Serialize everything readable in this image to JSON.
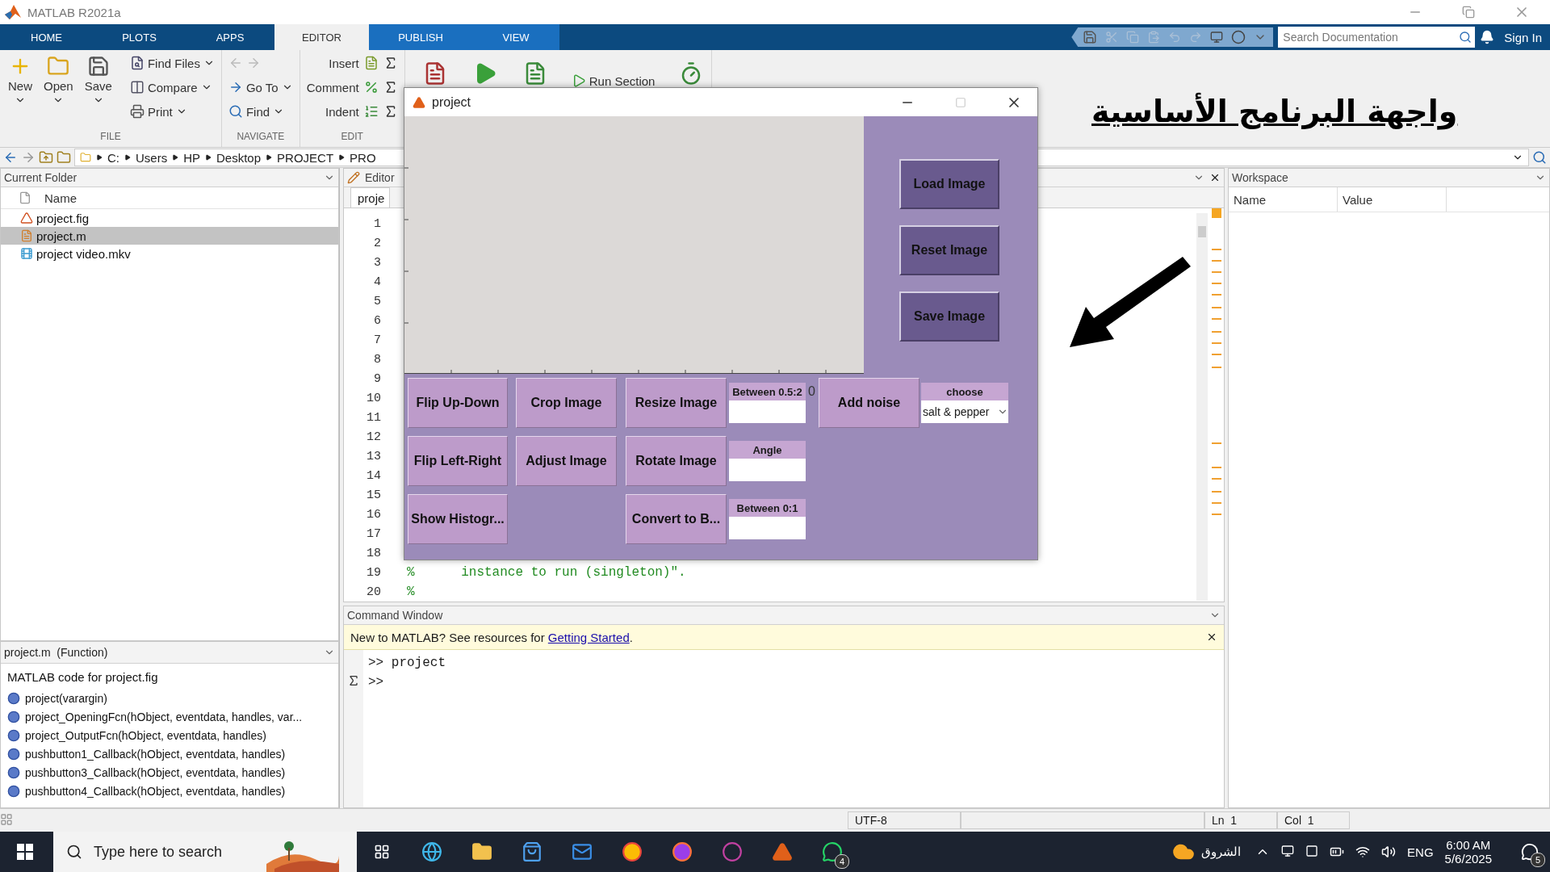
{
  "window": {
    "title": "MATLAB R2021a"
  },
  "ribbon_tabs": [
    {
      "label": "HOME",
      "selected": false,
      "contextual": false
    },
    {
      "label": "PLOTS",
      "selected": false,
      "contextual": false
    },
    {
      "label": "APPS",
      "selected": false,
      "contextual": false
    },
    {
      "label": "EDITOR",
      "selected": true,
      "contextual": false
    },
    {
      "label": "PUBLISH",
      "selected": false,
      "contextual": true
    },
    {
      "label": "VIEW",
      "selected": false,
      "contextual": true
    }
  ],
  "search": {
    "placeholder": "Search Documentation"
  },
  "sign_in": "Sign In",
  "toolstrip": [
    {
      "title": "FILE",
      "items": [
        {
          "label": "New",
          "kind": "large"
        },
        {
          "label": "Open",
          "kind": "large"
        },
        {
          "label": "Save",
          "kind": "large"
        },
        {
          "label": "Find Files",
          "kind": "small"
        },
        {
          "label": "Compare",
          "kind": "small"
        },
        {
          "label": "Print",
          "kind": "small"
        }
      ]
    },
    {
      "title": "NAVIGATE",
      "items": [
        {
          "kind": "arrows"
        },
        {
          "label": "Go To",
          "kind": "small"
        },
        {
          "label": "Find",
          "kind": "small"
        }
      ]
    },
    {
      "title": "EDIT",
      "items": [
        {
          "label": "Insert",
          "kind": "tool"
        },
        {
          "label": "Comment",
          "kind": "tool"
        },
        {
          "label": "Indent",
          "kind": "tool"
        }
      ]
    },
    {
      "items": [
        {
          "kind": "icon"
        },
        {
          "kind": "icon"
        },
        {
          "kind": "icon"
        },
        {
          "label": "Run Section",
          "kind": "small"
        },
        {
          "kind": "icon"
        }
      ]
    }
  ],
  "address_bar": {
    "path": [
      "C:",
      "Users",
      "HP",
      "Desktop",
      "PROJECT",
      "PRO"
    ]
  },
  "current_folder": {
    "title": "Current Folder",
    "column": "Name",
    "files": [
      {
        "name": "project.fig",
        "selected": false
      },
      {
        "name": "project.m",
        "selected": true
      },
      {
        "name": "project video.mkv",
        "selected": false
      }
    ]
  },
  "details": {
    "title": "project.m  (Function)",
    "description": "MATLAB code for project.fig",
    "functions": [
      "project(varargin)",
      "project_OpeningFcn(hObject, eventdata, handles, var...",
      "project_OutputFcn(hObject, eventdata, handles)",
      "pushbutton1_Callback(hObject, eventdata, handles)",
      "pushbutton3_Callback(hObject, eventdata, handles)",
      "pushbutton4_Callback(hObject, eventdata, handles)"
    ]
  },
  "editor": {
    "title": "Editor",
    "tab": "proje",
    "lines": [
      {
        "number": "1"
      },
      {
        "number": "2"
      },
      {
        "number": "3"
      },
      {
        "number": "4"
      },
      {
        "number": "5"
      },
      {
        "number": "6"
      },
      {
        "number": "7"
      },
      {
        "number": "8"
      },
      {
        "number": "9"
      },
      {
        "number": "10"
      },
      {
        "number": "11"
      },
      {
        "number": "12"
      },
      {
        "number": "13"
      },
      {
        "number": "14"
      },
      {
        "number": "15"
      },
      {
        "number": "16"
      },
      {
        "number": "17"
      },
      {
        "number": "18"
      },
      {
        "number": "19",
        "code": "%      instance to run (singleton)\"."
      },
      {
        "number": "20",
        "code": "%"
      }
    ]
  },
  "command_window": {
    "title": "Command Window",
    "banner": {
      "text": "New to MATLAB? See resources for ",
      "link": "Getting Started",
      "end": "."
    },
    "lines": [
      ">> project",
      ">>"
    ]
  },
  "workspace": {
    "title": "Workspace",
    "columns": [
      "Name",
      "Value"
    ]
  },
  "annotation": {
    "text": "واجهة البرنامج الأساسية"
  },
  "figure": {
    "title": "project",
    "side_buttons": [
      "Load Image",
      "Reset Image",
      "Save Image"
    ],
    "columns": [
      [
        {
          "kind": "button",
          "label": "Flip Up-Down"
        },
        {
          "kind": "button",
          "label": "Flip Left-Right"
        },
        {
          "kind": "button",
          "label": "Show Histogr..."
        }
      ],
      [
        {
          "kind": "button",
          "label": "Crop Image"
        },
        {
          "kind": "button",
          "label": "Adjust Image"
        }
      ],
      [
        {
          "kind": "button",
          "label": "Resize Image"
        },
        {
          "kind": "button",
          "label": "Rotate Image"
        },
        {
          "kind": "button",
          "label": "Convert to B..."
        }
      ],
      [
        {
          "kind": "field",
          "label": "Between 0.5:2",
          "overflow": "0"
        },
        {
          "kind": "field",
          "label": "Angle"
        },
        {
          "kind": "field",
          "label": "Between 0:1"
        }
      ],
      [
        {
          "kind": "button",
          "label": "Add noise"
        }
      ],
      [
        {
          "kind": "dropdown",
          "label": "choose",
          "value": "salt & pepper"
        }
      ]
    ]
  },
  "status_bar": {
    "encoding": "UTF-8",
    "line": "Ln  1",
    "column": "Col  1"
  },
  "taskbar": {
    "search": {
      "placeholder": "Type here to search"
    },
    "chat_badge": "4",
    "weather": "الشروق",
    "language": "ENG",
    "time": "6:00 AM",
    "date": "5/6/2025",
    "notifications": "5"
  }
}
